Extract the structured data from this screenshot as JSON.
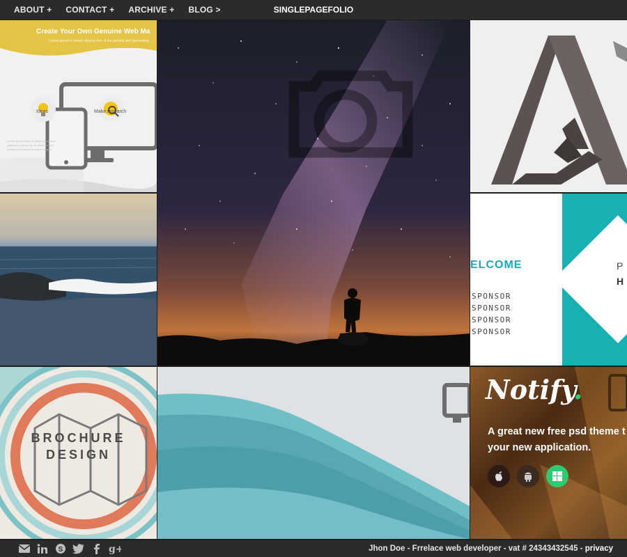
{
  "nav": {
    "items": [
      {
        "label": "ABOUT +"
      },
      {
        "label": "CONTACT +"
      },
      {
        "label": "ARCHIVE +"
      },
      {
        "label": "BLOG >"
      }
    ],
    "brand": "SINGLEPAGEFOLIO"
  },
  "tiles": {
    "web": {
      "title": "Create Your Own Genuine Web Ma",
      "subtitle": "Lorem ipsum is simply dummy text of the printing and typesetting",
      "feature1": "Ideas",
      "feature2": "Make research",
      "icon1": "lightbulb-icon",
      "icon2": "search-gear-icon"
    },
    "sponsor": {
      "welcome": "ELCOME",
      "lines": [
        "SPONSOR",
        "SPONSOR",
        "SPONSOR",
        "SPONSOR"
      ],
      "p": "P",
      "h": "H"
    },
    "brochure": {
      "line1": "BROCHURE",
      "line2": "DESIGN"
    },
    "notify": {
      "title": "Notify",
      "dot": ".",
      "line1": "A great new free psd theme t",
      "line2": "your new application."
    }
  },
  "footer": {
    "social": [
      "envelope-icon",
      "linkedin-icon",
      "skype-icon",
      "twitter-icon",
      "facebook-icon",
      "googleplus-icon"
    ],
    "credit": "Jhon Doe - Frrelace web developer - vat # 24343432545 - ",
    "privacy": "privacy"
  },
  "colors": {
    "bar": "#2b2b2b",
    "yellow": "#e4c445",
    "teal": "#18b0b0",
    "green": "#2ecc71",
    "coral": "#e07a5a"
  }
}
